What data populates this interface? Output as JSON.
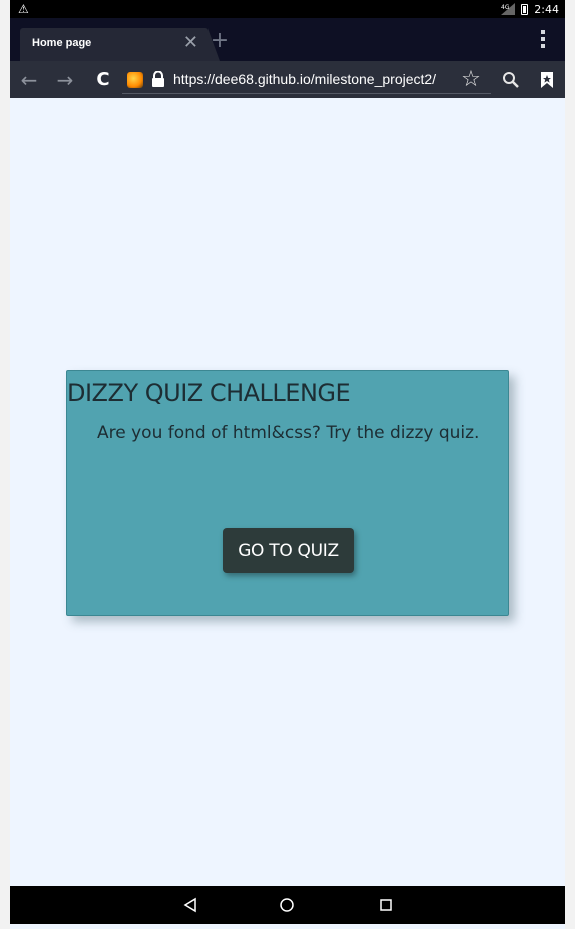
{
  "status_bar": {
    "warning_icon": "warning-icon",
    "network_label": "4G",
    "time": "2:44"
  },
  "tabs": [
    {
      "title": "Home page",
      "active": true
    }
  ],
  "toolbar": {
    "url": "https://dee68.github.io/milestone_project2/",
    "icons": [
      "back-arrow-icon",
      "forward-arrow-icon",
      "reload-icon",
      "site-favicon",
      "lock-icon",
      "star-icon",
      "search-icon",
      "bookmark-icon"
    ]
  },
  "content": {
    "card": {
      "title": "DIZZY QUIZ CHALLENGE",
      "subtitle": "Are you fond of html&css? Try the dizzy quiz.",
      "button_label": "GO TO QUIZ"
    }
  },
  "nav_bar": {
    "icons": [
      "back-triangle-icon",
      "home-circle-icon",
      "recents-square-icon"
    ]
  },
  "colors": {
    "card_background": "#51a3b0",
    "button_background": "#2d3b3a",
    "page_background": "#eef5ff",
    "toolbar_background": "#2b2f3b",
    "tab_bar_background": "#0e1024"
  }
}
